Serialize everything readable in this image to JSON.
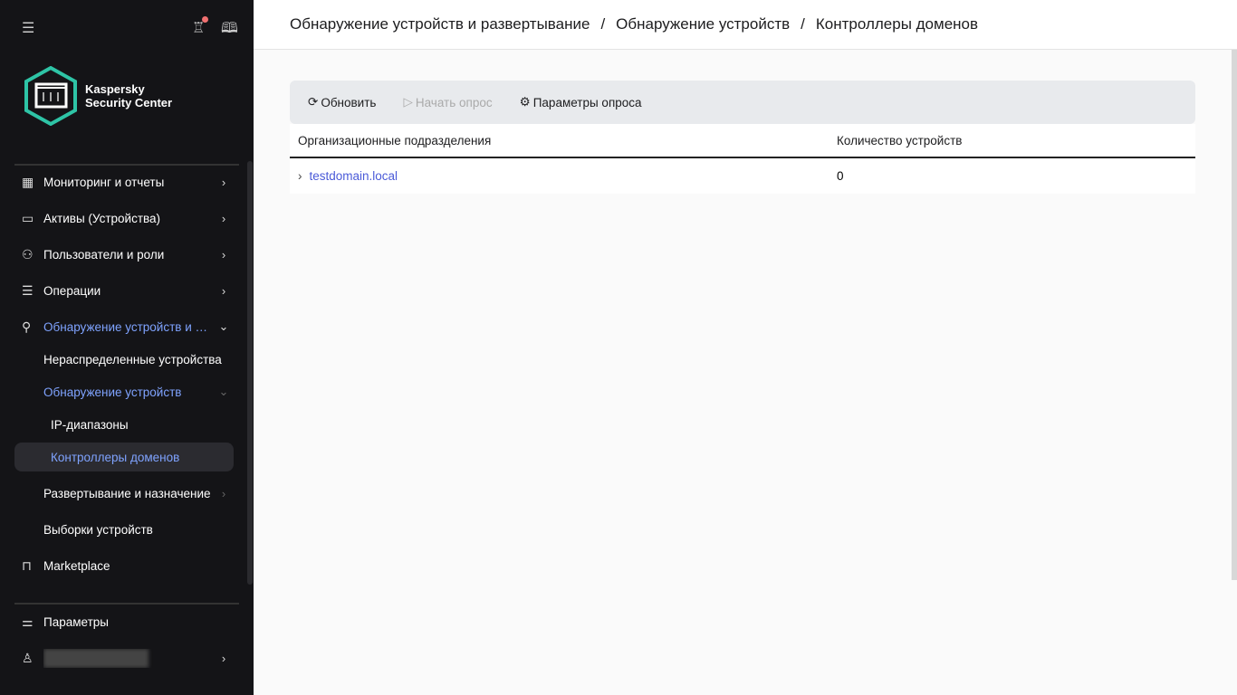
{
  "sidebar": {
    "logo_line1": "Kaspersky",
    "logo_line2": "Security Center",
    "items": [
      {
        "label": "Мониторинг и отчеты",
        "icon": "dashboard-icon"
      },
      {
        "label": "Активы (Устройства)",
        "icon": "monitor-icon"
      },
      {
        "label": "Пользователи и роли",
        "icon": "users-icon"
      },
      {
        "label": "Операции",
        "icon": "server-icon"
      },
      {
        "label": "Обнаружение устройств и развертывание",
        "icon": "search-icon"
      },
      {
        "label": "Нераспределенные устройства"
      },
      {
        "label": "Обнаружение устройств"
      },
      {
        "label": "IP-диапазоны"
      },
      {
        "label": "Контроллеры доменов"
      },
      {
        "label": "Развертывание и назначение"
      },
      {
        "label": "Выборки устройств"
      },
      {
        "label": "Marketplace",
        "icon": "bag-icon"
      }
    ],
    "settings": "Параметры",
    "colors": {
      "accent": "#7fa3ff",
      "bg": "#141417",
      "logo": "#2ec4a6"
    }
  },
  "breadcrumb": [
    "Обнаружение устройств и развертывание",
    "Обнаружение устройств",
    "Контроллеры доменов"
  ],
  "toolbar": {
    "refresh": "Обновить",
    "start": "Начать опрос",
    "params": "Параметры опроса"
  },
  "table": {
    "headers": [
      "Организационные подразделения",
      "Количество устройств"
    ],
    "rows": [
      {
        "name": "testdomain.local",
        "count": "0"
      }
    ]
  }
}
